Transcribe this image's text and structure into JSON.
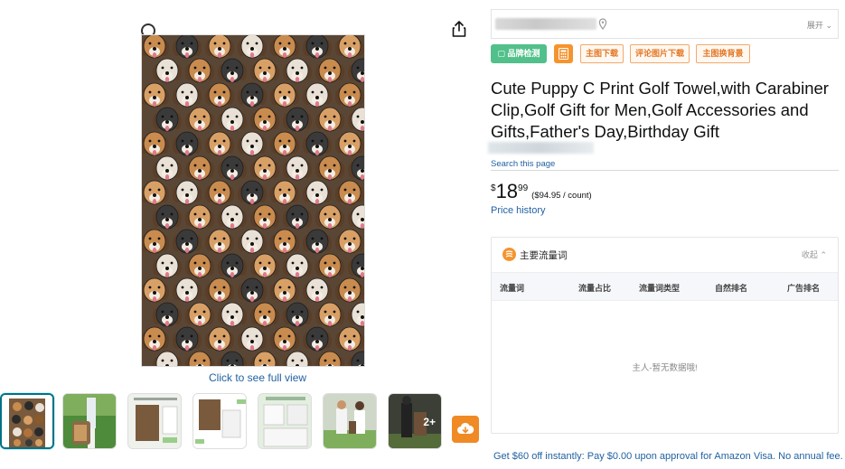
{
  "gallery": {
    "full_view_link": "Click to see full view",
    "thumbnails": [
      {
        "kind": "dogs",
        "active": true
      },
      {
        "kind": "golfer",
        "active": false
      },
      {
        "kind": "parameters-sheet",
        "active": false
      },
      {
        "kind": "towel-size",
        "active": false
      },
      {
        "kind": "detail-display",
        "active": false
      },
      {
        "kind": "golf-couple",
        "active": false
      },
      {
        "kind": "golf-bag",
        "active": false,
        "more_label": "2+"
      }
    ]
  },
  "address_bar": {
    "expand_label": "展开"
  },
  "toolbar": {
    "brand_check": "品牌检测",
    "download_main": "主图下载",
    "download_reviews": "评论图片下载",
    "replace_background": "主图换背景"
  },
  "product": {
    "title": "Cute Puppy C Print Golf Towel,with Carabiner Clip,Golf Gift for Men,Golf Accessories and Gifts,Father's Day,Birthday Gift",
    "search_page_link": "Search this page",
    "price": {
      "currency": "$",
      "whole": "18",
      "fraction": "99",
      "unit_price": "($94.95 / count)"
    },
    "price_history_link": "Price history"
  },
  "keywords_panel": {
    "title": "主要流量词",
    "collapse_label": "收起",
    "columns": [
      "流量词",
      "流量占比",
      "流量词类型",
      "自然排名",
      "广告排名"
    ],
    "empty_message": "主人-暂无数据哦!"
  },
  "promo_text": "Get $60 off instantly: Pay $0.00 upon approval for Amazon Visa. No annual fee.",
  "colors": {
    "link": "#2162a1",
    "accent_orange": "#f08a24",
    "brand_green": "#52c08a",
    "active_thumb_border": "#007185"
  }
}
